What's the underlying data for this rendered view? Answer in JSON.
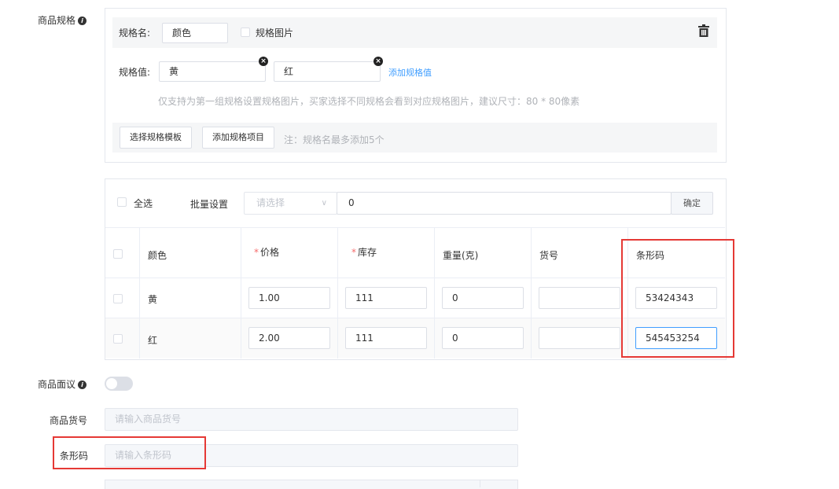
{
  "spec_section": {
    "label": "商品规格",
    "spec_name_label": "规格名:",
    "spec_name_value": "颜色",
    "spec_image_label": "规格图片",
    "spec_values_label": "规格值:",
    "spec_values": [
      "黄",
      "红"
    ],
    "add_value_link": "添加规格值",
    "hint": "仅支持为第一组规格设置规格图片，买家选择不同规格会看到对应规格图片，建议尺寸：80 * 80像素",
    "template_button": "选择规格模板",
    "add_item_button": "添加规格项目",
    "note": "注：规格名最多添加5个"
  },
  "batch": {
    "select_all_label": "全选",
    "batch_label": "批量设置",
    "select_placeholder": "请选择",
    "input_value": "0",
    "confirm_button": "确定"
  },
  "table": {
    "headers": {
      "color": "颜色",
      "price": "价格",
      "stock": "库存",
      "weight": "重量(克)",
      "sku": "货号",
      "barcode": "条形码"
    },
    "required_mark": "*",
    "rows": [
      {
        "color": "黄",
        "price": "1.00",
        "stock": "111",
        "weight": "0",
        "sku": "",
        "barcode": "53424343"
      },
      {
        "color": "红",
        "price": "2.00",
        "stock": "111",
        "weight": "0",
        "sku": "",
        "barcode": "545453254"
      }
    ]
  },
  "negotiable": {
    "label": "商品面议",
    "enabled": false
  },
  "product_sku": {
    "label": "商品货号",
    "placeholder": "请输入商品货号"
  },
  "product_barcode": {
    "label": "条形码",
    "placeholder": "请输入条形码"
  },
  "colors": {
    "highlight": "#e53935",
    "link": "#409eff",
    "required": "#f56c6c"
  }
}
